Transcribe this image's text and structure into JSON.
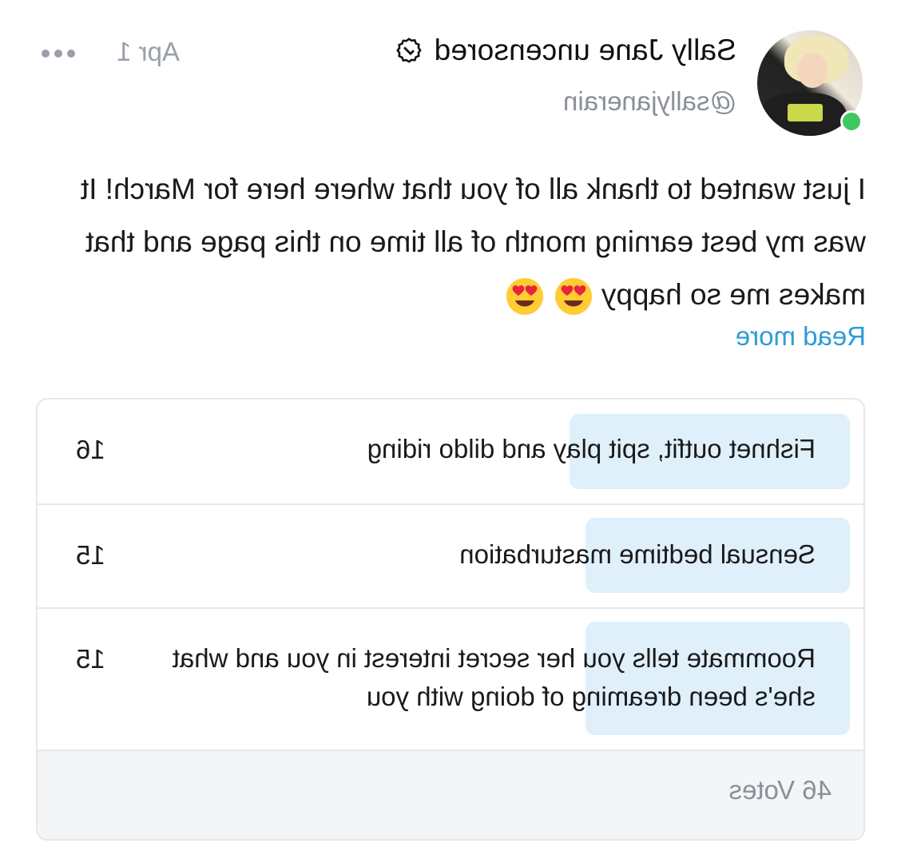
{
  "post": {
    "author_name": "Sally Jane uncensored",
    "author_handle": "@sallyjanerain",
    "date": "Apr 1",
    "text": "I just wanted to thank all of you that where here for March! It was my best earning month of all time on this page and that makes me so happy",
    "emoji": "heart-eyes-emoji",
    "read_more": "Read more"
  },
  "poll": {
    "options": [
      {
        "label": "Fishnet outfit, spit play and dildo riding",
        "votes": "16",
        "fraction": 0.35
      },
      {
        "label": "Sensual bedtime masturbation",
        "votes": "15",
        "fraction": 0.33
      },
      {
        "label": "Roommate tells you her secret interest in you and what she's been dreaming of doing with you",
        "votes": "15",
        "fraction": 0.33
      }
    ],
    "total": "46 Votes"
  },
  "colors": {
    "accent": "#2f9bd6",
    "online": "#3ec85f",
    "poll_bar": "#dff0fb"
  }
}
